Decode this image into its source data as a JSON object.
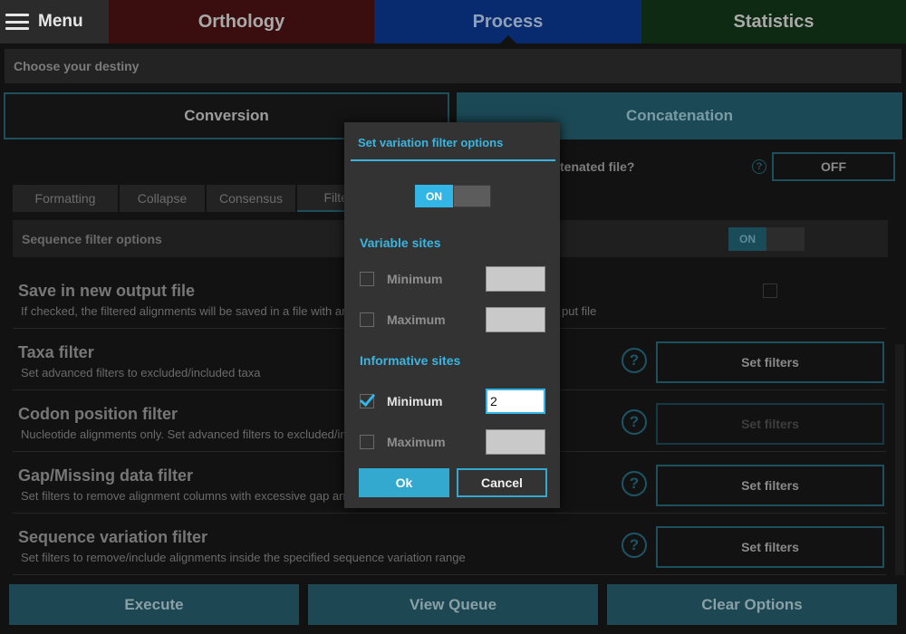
{
  "topbar": {
    "menu_label": "Menu",
    "tabs": [
      {
        "label": "Orthology",
        "color": "#3a0e0e"
      },
      {
        "label": "Process",
        "color": "#082a6e"
      },
      {
        "label": "Statistics",
        "color": "#0f2a12"
      }
    ]
  },
  "destiny": {
    "label": "Choose your destiny"
  },
  "modes": {
    "conversion": "Conversion",
    "concatenation": "Concatenation"
  },
  "concat_option": {
    "question": "tenated file?",
    "help": "?",
    "toggle": "OFF"
  },
  "subtabs": [
    "Formatting",
    "Collapse",
    "Consensus",
    "Filter"
  ],
  "sequence_filter": {
    "label": "Sequence filter options",
    "switch_on": "ON"
  },
  "filters": [
    {
      "title": "Save in new output file",
      "desc": "If checked, the filtered alignments will be saved in a file with an",
      "desc_right": "put file"
    },
    {
      "title": "Taxa filter",
      "desc": "Set advanced filters to excluded/included taxa",
      "help": "?",
      "button": "Set filters"
    },
    {
      "title": "Codon position filter",
      "desc": "Nucleotide alignments only. Set advanced filters to excluded/inc",
      "help": "?",
      "button": "Set filters"
    },
    {
      "title": "Gap/Missing data filter",
      "desc": "Set filters to remove alignment columns with excessive gap anc",
      "help": "?",
      "button": "Set filters"
    },
    {
      "title": "Sequence variation filter",
      "desc": "Set filters to remove/include alignments inside the specified sequence variation range",
      "help": "?",
      "button": "Set filters"
    }
  ],
  "bottom": {
    "execute": "Execute",
    "view_queue": "View Queue",
    "clear_options": "Clear Options"
  },
  "dialog": {
    "title": "Set variation filter options",
    "switch_on": "ON",
    "variable_sites": {
      "label": "Variable sites",
      "minimum": {
        "label": "Minimum",
        "checked": false,
        "value": ""
      },
      "maximum": {
        "label": "Maximum",
        "checked": false,
        "value": ""
      }
    },
    "informative_sites": {
      "label": "Informative sites",
      "minimum": {
        "label": "Minimum",
        "checked": true,
        "value": "2"
      },
      "maximum": {
        "label": "Maximum",
        "checked": false,
        "value": ""
      }
    },
    "ok": "Ok",
    "cancel": "Cancel",
    "accent": "#33b5e5"
  }
}
